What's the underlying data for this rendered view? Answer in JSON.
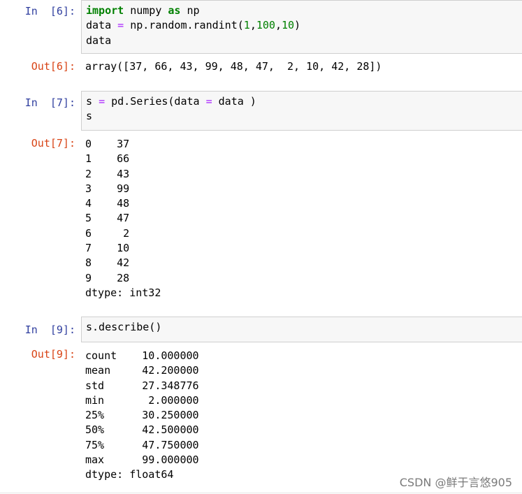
{
  "cells": [
    {
      "in_prompt": "In  [6]:",
      "code": {
        "line1": {
          "kw1": "import",
          "t1": " numpy ",
          "kw2": "as",
          "t2": " np"
        },
        "line2": {
          "t1": "data ",
          "op": "=",
          "t2": " np.random.randint(",
          "n1": "1",
          "c1": ",",
          "n2": "100",
          "c2": ",",
          "n3": "10",
          "t3": ")"
        },
        "line3": "data"
      },
      "out_prompt": "Out[6]:",
      "output": [
        "array([37, 66, 43, 99, 48, 47,  2, 10, 42, 28])"
      ]
    },
    {
      "in_prompt": "In  [7]:",
      "code": {
        "line1": {
          "t1": "s ",
          "op": "=",
          "t2": " pd.Series(data ",
          "op2": "=",
          "t3": " data )"
        },
        "line2": "s"
      },
      "out_prompt": "Out[7]:",
      "output": [
        "0    37",
        "1    66",
        "2    43",
        "3    99",
        "4    48",
        "5    47",
        "6     2",
        "7    10",
        "8    42",
        "9    28",
        "dtype: int32"
      ]
    },
    {
      "in_prompt": "In  [9]:",
      "code": {
        "line1": "s.describe()"
      },
      "out_prompt": "Out[9]:",
      "output": [
        "count    10.000000",
        "mean     42.200000",
        "std      27.348776",
        "min       2.000000",
        "25%      30.250000",
        "50%      42.500000",
        "75%      47.750000",
        "max      99.000000",
        "dtype: float64"
      ]
    }
  ],
  "watermark": "CSDN @鲜于言悠905",
  "colors": {
    "in_prompt": "#303f9f",
    "out_prompt": "#d84315",
    "keyword": "#008000",
    "number": "#008000",
    "operator": "#aa22ff",
    "input_bg": "#f7f7f7",
    "input_border": "#cfcfcf"
  }
}
